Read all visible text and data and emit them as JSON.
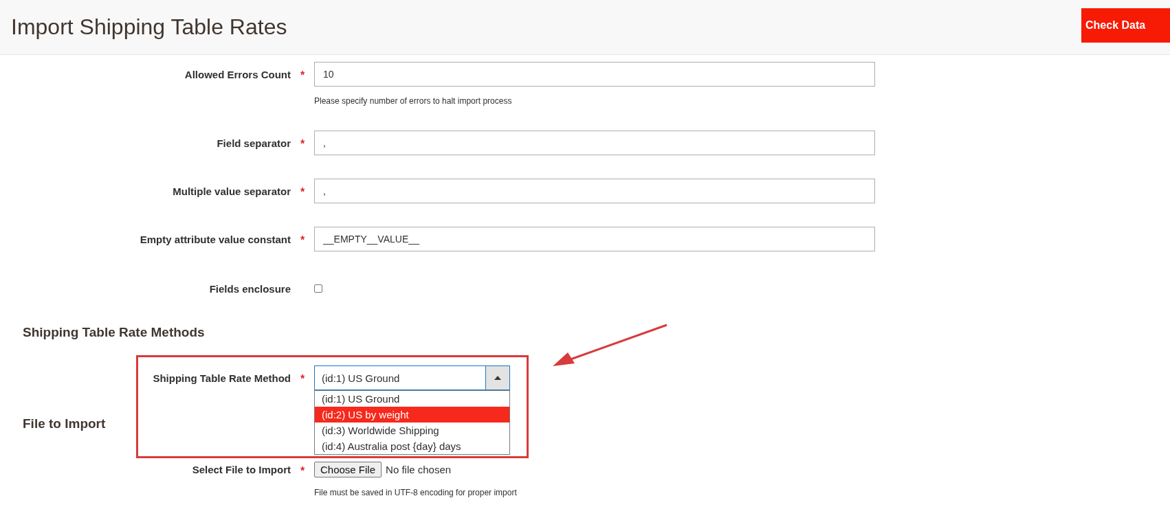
{
  "header": {
    "title": "Import Shipping Table Rates",
    "button": "Check Data"
  },
  "fields": [
    {
      "kind": "text",
      "label": "Allowed Errors Count",
      "required_mark": "*",
      "value": "10",
      "note": "Please specify number of errors to halt import process"
    },
    {
      "kind": "text",
      "label": "Field separator",
      "required_mark": "*",
      "value": ","
    },
    {
      "kind": "text",
      "label": "Multiple value separator",
      "required_mark": "*",
      "value": ","
    },
    {
      "kind": "text",
      "label": "Empty attribute value constant",
      "required_mark": "*",
      "value": "__EMPTY__VALUE__"
    },
    {
      "kind": "checkbox",
      "label": "Fields enclosure",
      "checked": false
    }
  ],
  "method_section": {
    "title": "Shipping Table Rate Methods",
    "label": "Shipping Table Rate Method",
    "required_mark": "*",
    "value": "(id:1) US Ground",
    "expanded": true,
    "options": [
      {
        "label": "(id:1) US Ground",
        "highlighted": false
      },
      {
        "label": "(id:2) US by weight",
        "highlighted": true
      },
      {
        "label": "(id:3) Worldwide Shipping",
        "highlighted": false
      },
      {
        "label": "(id:4) Australia post {day} days",
        "highlighted": false
      }
    ]
  },
  "file_section": {
    "title": "File to Import",
    "label": "Select File to Import",
    "required_mark": "*",
    "button": "Choose File",
    "status": "No file chosen",
    "note": "File must be saved in UTF-8 encoding for proper import"
  }
}
